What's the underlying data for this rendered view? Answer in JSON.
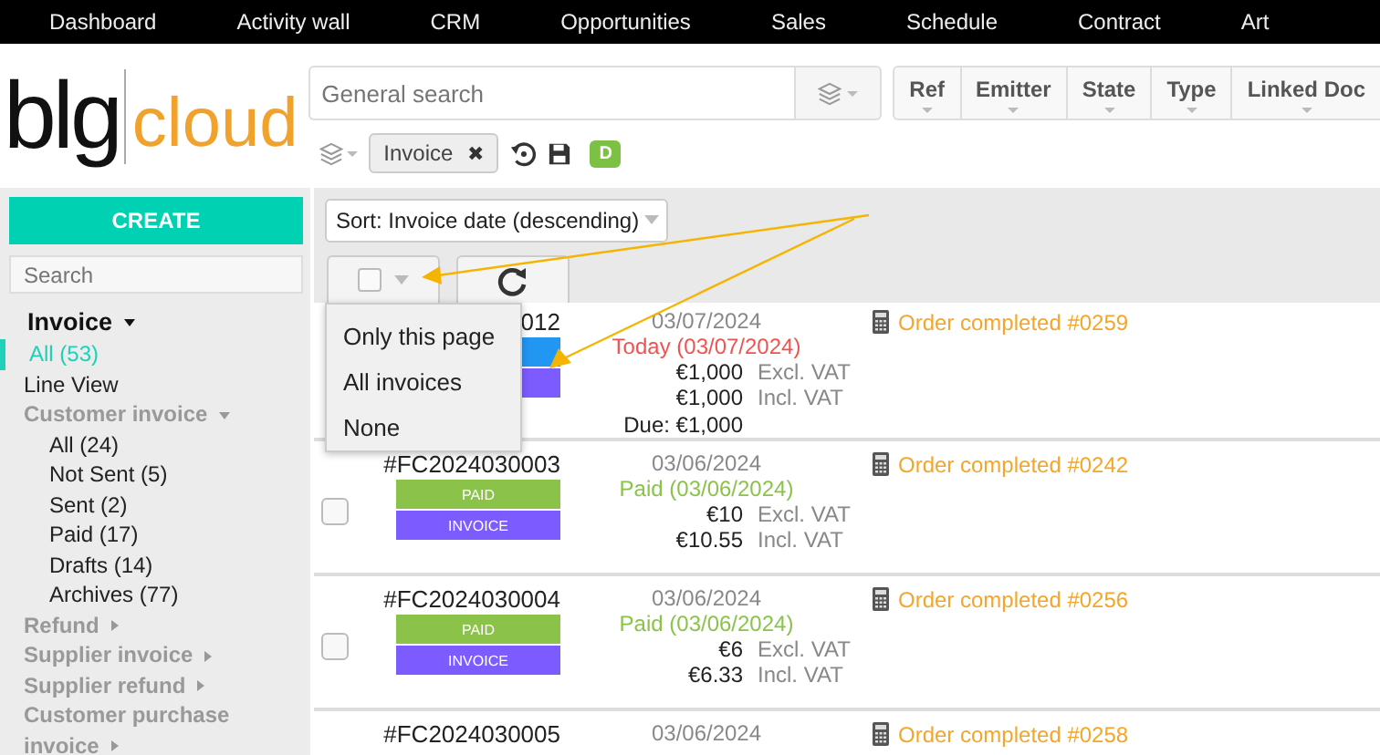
{
  "nav": [
    "Dashboard",
    "Activity wall",
    "CRM",
    "Opportunities",
    "Sales",
    "Schedule",
    "Contract",
    "Art"
  ],
  "logo": {
    "mark": "blg",
    "word": "cloud"
  },
  "search": {
    "placeholder": "General search"
  },
  "columns": [
    "Ref",
    "Emitter",
    "State",
    "Type",
    "Linked Doc"
  ],
  "filter_chip": {
    "label": "Invoice",
    "close": "✖"
  },
  "badge": "D",
  "sidebar": {
    "create": "CREATE",
    "search_placeholder": "Search",
    "tree": [
      {
        "label": "Invoice",
        "kind": "root",
        "expanded": true,
        "children": [
          {
            "label": "All (53)",
            "kind": "link",
            "selected": true
          },
          {
            "label": "Line View",
            "kind": "link",
            "selected": false
          },
          {
            "label": "Customer invoice",
            "kind": "group",
            "expanded": true,
            "children": [
              {
                "label": "All (24)",
                "kind": "link",
                "selected": false
              },
              {
                "label": "Not Sent (5)",
                "kind": "link",
                "selected": false
              },
              {
                "label": "Sent (2)",
                "kind": "link",
                "selected": false
              },
              {
                "label": "Paid (17)",
                "kind": "link",
                "selected": false
              },
              {
                "label": "Drafts (14)",
                "kind": "link",
                "selected": false
              },
              {
                "label": "Archives (77)",
                "kind": "link",
                "selected": false
              }
            ]
          },
          {
            "label": "Refund",
            "kind": "group",
            "expanded": false
          },
          {
            "label": "Supplier invoice",
            "kind": "group",
            "expanded": false
          },
          {
            "label": "Supplier refund",
            "kind": "group",
            "expanded": false
          },
          {
            "label": "Customer purchase invoice",
            "kind": "group",
            "expanded": false
          }
        ]
      }
    ]
  },
  "sort": "Sort: Invoice date (descending)",
  "select_menu": [
    "Only this page",
    "All invoices",
    "None"
  ],
  "rows": [
    {
      "ref": "012",
      "badges": [
        {
          "color": "#2196f3"
        },
        {
          "color": "#7c5cff"
        }
      ],
      "date": "03/07/2024",
      "status": {
        "kind": "due",
        "text": "Today (03/07/2024)"
      },
      "totals": {
        "excl_vat": {
          "amount": "€1,000",
          "note": "Excl. VAT"
        },
        "incl_vat": {
          "amount": "€1,000",
          "note": "Incl. VAT"
        },
        "due": "Due: €1,000"
      },
      "link": "Order completed #0259"
    },
    {
      "ref": "#FC2024030003",
      "checked": false,
      "badges": [
        {
          "label": "PAID",
          "color": "#8bc34a"
        },
        {
          "label": "INVOICE",
          "color": "#7c5cff"
        }
      ],
      "date": "03/06/2024",
      "status": {
        "kind": "paid",
        "text": "Paid (03/06/2024)"
      },
      "totals": {
        "excl_vat": {
          "amount": "€10",
          "note": "Excl. VAT"
        },
        "incl_vat": {
          "amount": "€10.55",
          "note": "Incl. VAT"
        }
      },
      "link": "Order completed #0242"
    },
    {
      "ref": "#FC2024030004",
      "checked": false,
      "badges": [
        {
          "label": "PAID",
          "color": "#8bc34a"
        },
        {
          "label": "INVOICE",
          "color": "#7c5cff"
        }
      ],
      "date": "03/06/2024",
      "status": {
        "kind": "paid",
        "text": "Paid (03/06/2024)"
      },
      "totals": {
        "excl_vat": {
          "amount": "€6",
          "note": "Excl. VAT"
        },
        "incl_vat": {
          "amount": "€6.33",
          "note": "Incl. VAT"
        }
      },
      "link": "Order completed #0256"
    },
    {
      "ref": "#FC2024030005",
      "date": "03/06/2024",
      "link": "Order completed #0258"
    }
  ]
}
